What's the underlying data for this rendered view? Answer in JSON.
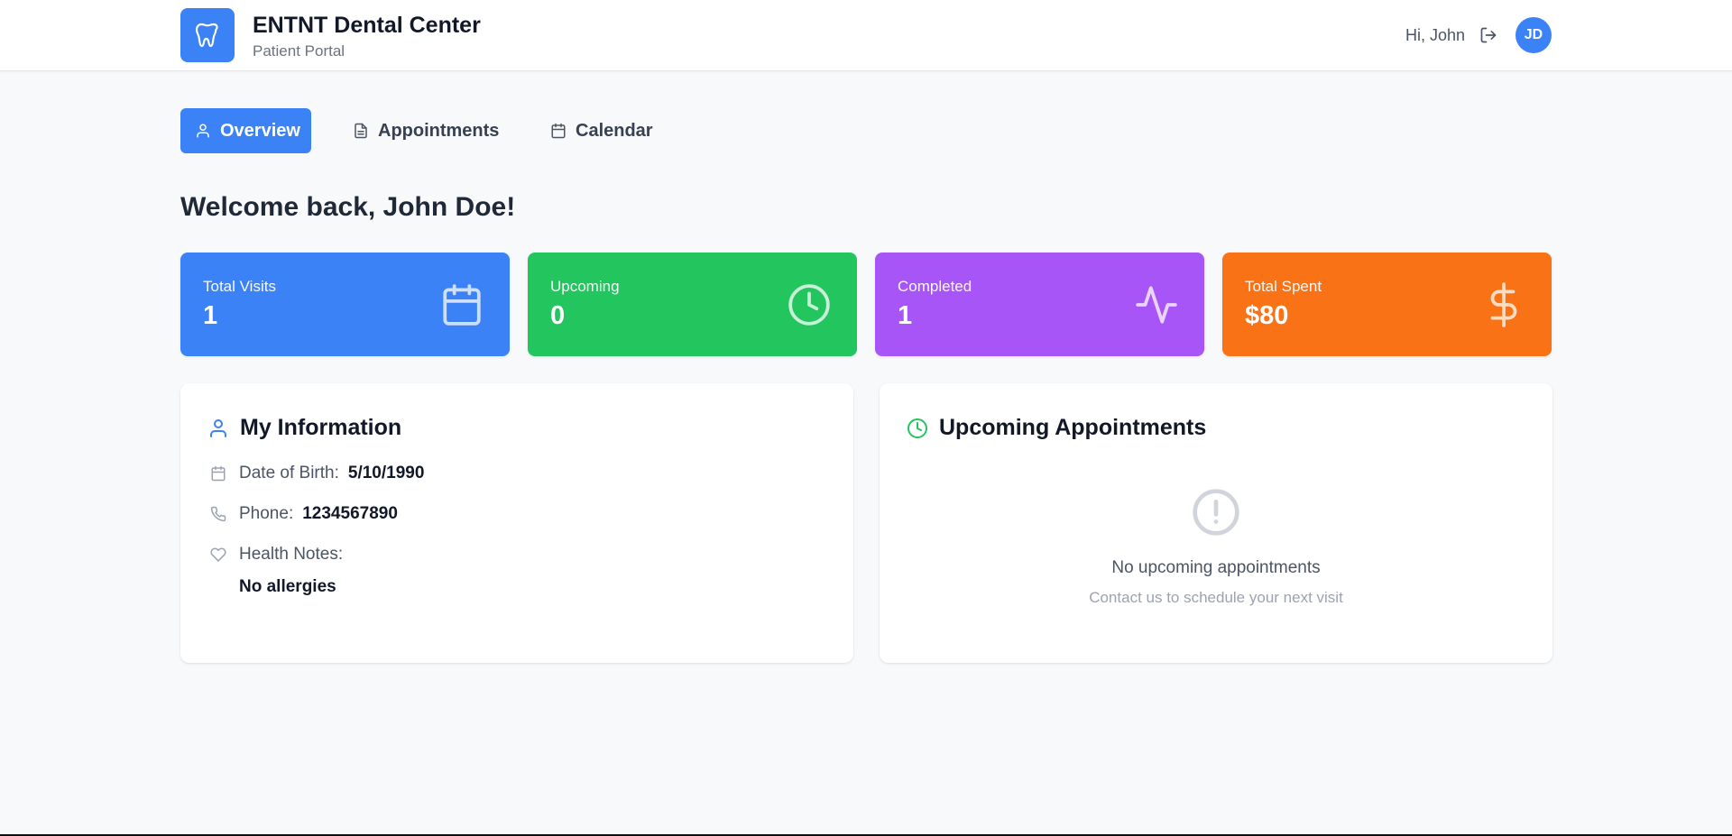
{
  "header": {
    "brand_title": "ENTNT Dental Center",
    "brand_subtitle": "Patient Portal",
    "greeting": "Hi, John",
    "avatar_initials": "JD",
    "logo_icon": "tooth-icon",
    "logout_icon": "logout-icon"
  },
  "tabs": [
    {
      "label": "Overview",
      "icon": "user-icon",
      "active": true
    },
    {
      "label": "Appointments",
      "icon": "document-icon",
      "active": false
    },
    {
      "label": "Calendar",
      "icon": "calendar-icon",
      "active": false
    }
  ],
  "welcome": "Welcome back, John Doe!",
  "stats": [
    {
      "label": "Total Visits",
      "value": "1",
      "icon": "calendar-icon",
      "color": "#3b82f6"
    },
    {
      "label": "Upcoming",
      "value": "0",
      "icon": "clock-icon",
      "color": "#22c55e"
    },
    {
      "label": "Completed",
      "value": "1",
      "icon": "activity-icon",
      "color": "#a855f7"
    },
    {
      "label": "Total Spent",
      "value": "$80",
      "icon": "dollar-icon",
      "color": "#f97316"
    }
  ],
  "my_info": {
    "title": "My Information",
    "dob_label": "Date of Birth:",
    "dob_value": "5/10/1990",
    "phone_label": "Phone:",
    "phone_value": "1234567890",
    "notes_label": "Health Notes:",
    "notes_value": "No allergies"
  },
  "upcoming": {
    "title": "Upcoming Appointments",
    "empty_title": "No upcoming appointments",
    "empty_subtitle": "Contact us to schedule your next visit"
  },
  "colors": {
    "primary": "#3b82f6",
    "green": "#22c55e",
    "purple": "#a855f7",
    "orange": "#f97316"
  }
}
